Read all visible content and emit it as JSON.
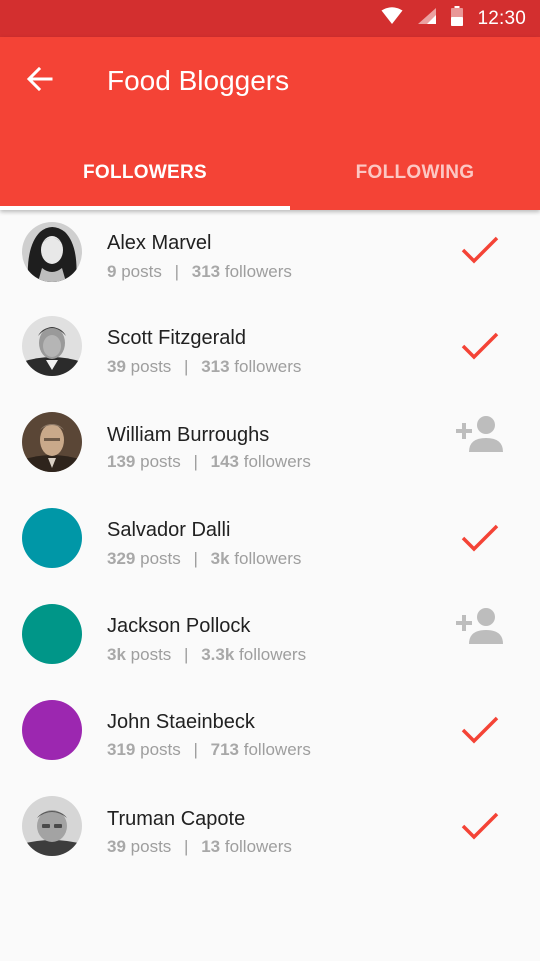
{
  "status_bar": {
    "time": "12:30",
    "icons": [
      "wifi-icon",
      "signal-icon",
      "battery-icon"
    ]
  },
  "app_bar": {
    "title": "Food Bloggers",
    "back_icon": "arrow-back-icon",
    "color": "#f44336",
    "status_color": "#d32f2f"
  },
  "tabs": [
    {
      "label": "FOLLOWERS",
      "selected": true
    },
    {
      "label": "FOLLOWING",
      "selected": false
    }
  ],
  "users": [
    {
      "name": "Alex Marvel",
      "posts": "9",
      "posts_label": "posts",
      "followers": "313",
      "followers_label": "followers",
      "avatar": "photo",
      "following": true
    },
    {
      "name": "Scott Fitzgerald",
      "posts": "39",
      "posts_label": "posts",
      "followers": "313",
      "followers_label": "followers",
      "avatar": "photo",
      "following": true
    },
    {
      "name": "William Burroughs",
      "posts": "139",
      "posts_label": "posts",
      "followers": "143",
      "followers_label": "followers",
      "avatar": "photo",
      "following": false
    },
    {
      "name": "Salvador Dalli",
      "posts": "329",
      "posts_label": "posts",
      "followers": "3k",
      "followers_label": "followers",
      "avatar_color": "#0097a7",
      "following": true
    },
    {
      "name": "Jackson Pollock",
      "posts": "3k",
      "posts_label": "posts",
      "followers": "3.3k",
      "followers_label": "followers",
      "avatar_color": "#009688",
      "following": false
    },
    {
      "name": "John Staeinbeck",
      "posts": "319",
      "posts_label": "posts",
      "followers": "713",
      "followers_label": "followers",
      "avatar_color": "#9c27b0",
      "following": true
    },
    {
      "name": "Truman Capote",
      "posts": "39",
      "posts_label": "posts",
      "followers": "13",
      "followers_label": "followers",
      "avatar": "photo",
      "following": true
    }
  ],
  "colors": {
    "check": "#f44336",
    "add_person": "#bdbdbd"
  }
}
